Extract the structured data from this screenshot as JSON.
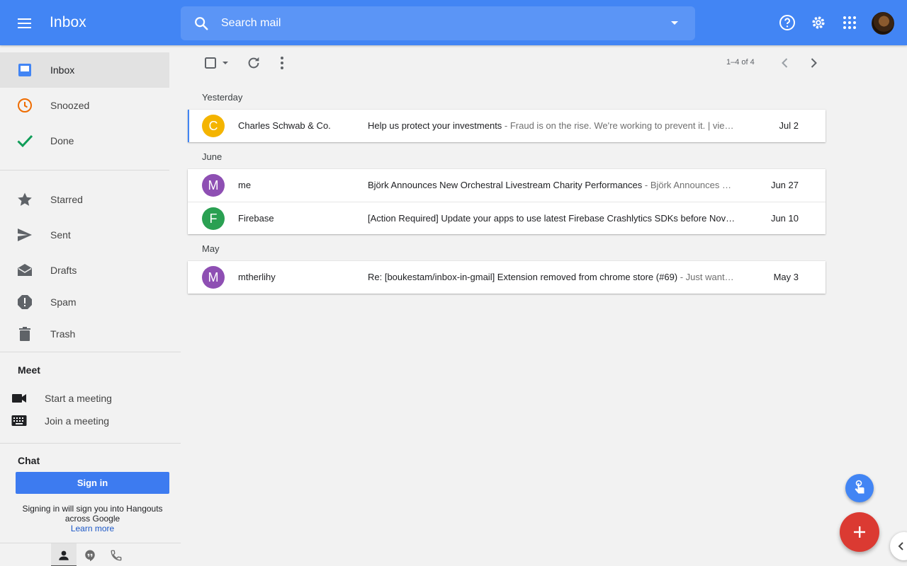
{
  "header": {
    "title": "Inbox",
    "search_placeholder": "Search mail",
    "icons": [
      "menu-icon",
      "search-icon",
      "dropdown-caret-icon",
      "help-icon",
      "settings-icon",
      "apps-icon",
      "avatar"
    ]
  },
  "sidebar": {
    "items": [
      {
        "label": "Inbox",
        "icon": "inbox-icon",
        "color": "#4285f4"
      },
      {
        "label": "Snoozed",
        "icon": "clock-icon",
        "color": "#ef6c00"
      },
      {
        "label": "Done",
        "icon": "check-icon",
        "color": "#0f9d58"
      },
      {
        "label": "Starred",
        "icon": "star-icon",
        "color": "#5f6368"
      },
      {
        "label": "Sent",
        "icon": "send-icon",
        "color": "#5f6368"
      },
      {
        "label": "Drafts",
        "icon": "drafts-icon",
        "color": "#5f6368"
      },
      {
        "label": "Spam",
        "icon": "spam-icon",
        "color": "#5f6368"
      },
      {
        "label": "Trash",
        "icon": "trash-icon",
        "color": "#5f6368"
      }
    ],
    "meet": {
      "title": "Meet",
      "start": "Start a meeting",
      "join": "Join a meeting"
    },
    "chat": {
      "title": "Chat",
      "sign_in": "Sign in",
      "note": "Signing in will sign you into Hangouts across Google",
      "learn_more": "Learn more"
    }
  },
  "toolbar": {
    "pager": "1–4 of 4"
  },
  "groups": [
    {
      "label": "Yesterday",
      "mails": [
        {
          "initial": "C",
          "avatar_color": "#f4b400",
          "sender": "Charles Schwab & Co.",
          "subject": "Help us protect your investments",
          "snippet": " - Fraud is on the rise. We're working to prevent it. | vie…",
          "date": "Jul 2"
        }
      ]
    },
    {
      "label": "June",
      "mails": [
        {
          "initial": "M",
          "avatar_color": "#8e4fb3",
          "sender": "me",
          "subject": "Björk Announces New Orchestral Livestream Charity Performances",
          "snippet": " - Björk Announces …",
          "date": "Jun 27"
        },
        {
          "initial": "F",
          "avatar_color": "#2aa052",
          "sender": "Firebase",
          "subject": "[Action Required] Update your apps to use latest Firebase Crashlytics SDKs before Nov…",
          "snippet": "",
          "date": "Jun 10"
        }
      ]
    },
    {
      "label": "May",
      "mails": [
        {
          "initial": "M",
          "avatar_color": "#8e4fb3",
          "sender": "mtherlihy",
          "subject": "Re: [boukestam/inbox-in-gmail] Extension removed from chrome store (#69)",
          "snippet": " - Just want…",
          "date": "May 3"
        }
      ]
    }
  ]
}
